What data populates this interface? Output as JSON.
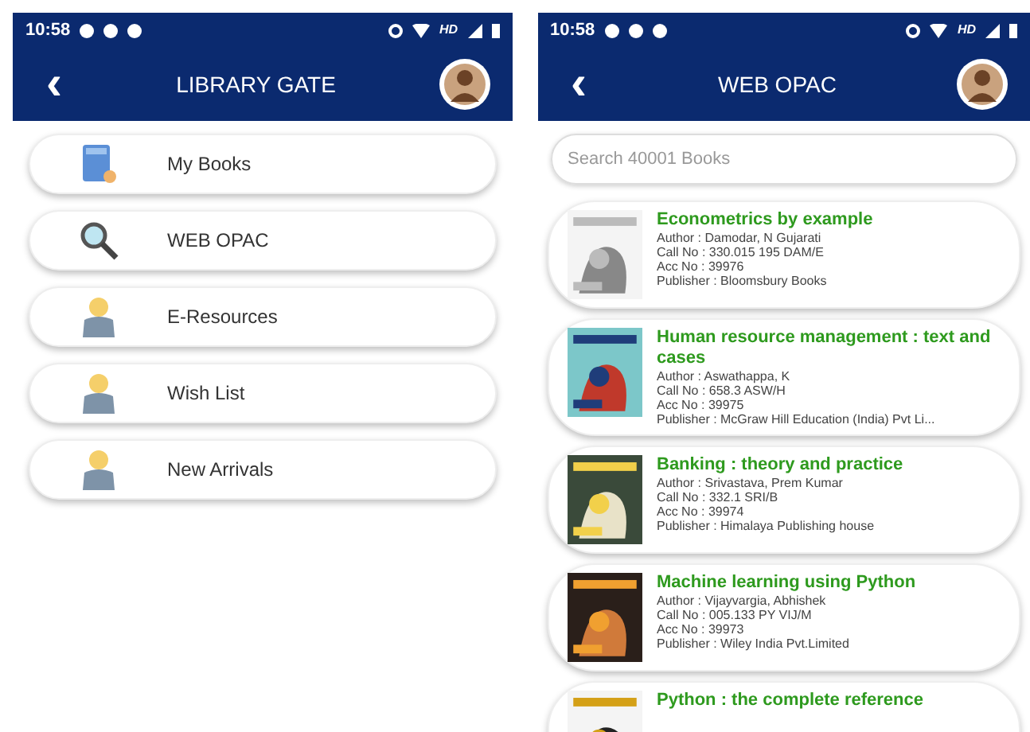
{
  "screens": [
    {
      "status_bar": {
        "time": "10:58",
        "network": "HD"
      },
      "header": {
        "back": "‹",
        "title": "LIBRARY GATE"
      },
      "menu": [
        {
          "kind": "book",
          "label": "My Books"
        },
        {
          "kind": "search",
          "label": "WEB OPAC"
        },
        {
          "kind": "person",
          "label": "E-Resources"
        },
        {
          "kind": "person",
          "label": "Wish List"
        },
        {
          "kind": "person",
          "label": "New Arrivals"
        }
      ]
    },
    {
      "status_bar": {
        "time": "10:58",
        "network": "HD"
      },
      "header": {
        "back": "‹",
        "title": "WEB OPAC"
      },
      "search": {
        "placeholder": "Search 40001 Books"
      },
      "books": [
        {
          "title": "Econometrics by example",
          "details": [
            "Author : Damodar, N Gujarati",
            "Call No : 330.015 195 DAM/E",
            "Acc No : 39976",
            "Publisher : Bloomsbury Books"
          ]
        },
        {
          "title": "Human resource management : text and cases",
          "details": [
            "Author : Aswathappa, K",
            "Call No : 658.3 ASW/H",
            "Acc No : 39975",
            "Publisher : McGraw Hill Education (India) Pvt Li..."
          ]
        },
        {
          "title": "Banking : theory and practice",
          "details": [
            "Author : Srivastava, Prem Kumar",
            "Call No : 332.1 SRI/B",
            "Acc No : 39974",
            "Publisher : Himalaya Publishing house"
          ]
        },
        {
          "title": "Machine learning using Python",
          "details": [
            "Author : Vijayvargia, Abhishek",
            "Call No : 005.133 PY VIJ/M",
            "Acc No : 39973",
            "Publisher : Wiley India Pvt.Limited"
          ]
        },
        {
          "title": "Python : the complete reference"
        }
      ]
    }
  ]
}
